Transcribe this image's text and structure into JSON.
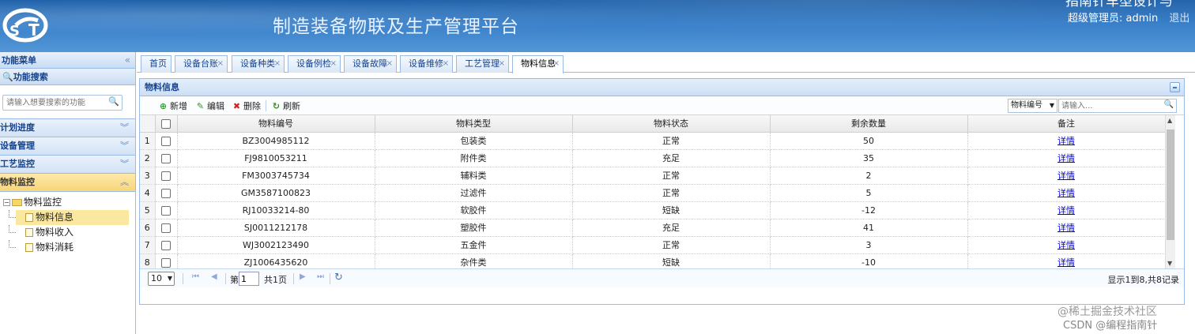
{
  "header": {
    "title": "制造装备物联及生产管理平台",
    "top_cut_text": "指南针车型设计与",
    "user_label": "超级管理员: admin",
    "logout_label": "退出"
  },
  "sidebar": {
    "menu_title": "功能菜单",
    "search_title": "功能搜索",
    "search_placeholder": "请输入想要搜索的功能",
    "sections": [
      "计划进度",
      "设备管理",
      "工艺监控",
      "物料监控"
    ],
    "tree": {
      "root": "物料监控",
      "children": [
        "物料信息",
        "物料收入",
        "物料消耗"
      ]
    }
  },
  "tabs": [
    "首页",
    "设备台账",
    "设备种类",
    "设备例检",
    "设备故障",
    "设备维修",
    "工艺管理",
    "物料信息"
  ],
  "panel": {
    "title": "物料信息",
    "toolbar": {
      "add": "新增",
      "edit": "编辑",
      "delete": "删除",
      "refresh": "刷新",
      "field_select": "物料编号",
      "search_placeholder": "请输入..."
    },
    "columns": [
      "物料编号",
      "物料类型",
      "物料状态",
      "剩余数量",
      "备注"
    ],
    "rows": [
      {
        "no": "1",
        "code": "BZ3004985112",
        "type": "包装类",
        "status": "正常",
        "qty": "50",
        "note": "详情"
      },
      {
        "no": "2",
        "code": "FJ9810053211",
        "type": "附件类",
        "status": "充足",
        "qty": "35",
        "note": "详情"
      },
      {
        "no": "3",
        "code": "FM3003745734",
        "type": "辅料类",
        "status": "正常",
        "qty": "2",
        "note": "详情"
      },
      {
        "no": "4",
        "code": "GM3587100823",
        "type": "过滤件",
        "status": "正常",
        "qty": "5",
        "note": "详情"
      },
      {
        "no": "5",
        "code": "RJ10033214-80",
        "type": "软胶件",
        "status": "短缺",
        "qty": "-12",
        "note": "详情"
      },
      {
        "no": "6",
        "code": "SJ0011212178",
        "type": "塑胶件",
        "status": "充足",
        "qty": "41",
        "note": "详情"
      },
      {
        "no": "7",
        "code": "WJ3002123490",
        "type": "五金件",
        "status": "正常",
        "qty": "3",
        "note": "详情"
      },
      {
        "no": "8",
        "code": "ZJ1006435620",
        "type": "杂件类",
        "status": "短缺",
        "qty": "-10",
        "note": "详情"
      }
    ],
    "pager": {
      "page_size": "10",
      "page_prefix": "第",
      "page_value": "1",
      "page_suffix": "共1页",
      "info": "显示1到8,共8记录"
    }
  },
  "watermark": {
    "line1": "@稀土掘金技术社区",
    "line2": "CSDN @编程指南针"
  }
}
